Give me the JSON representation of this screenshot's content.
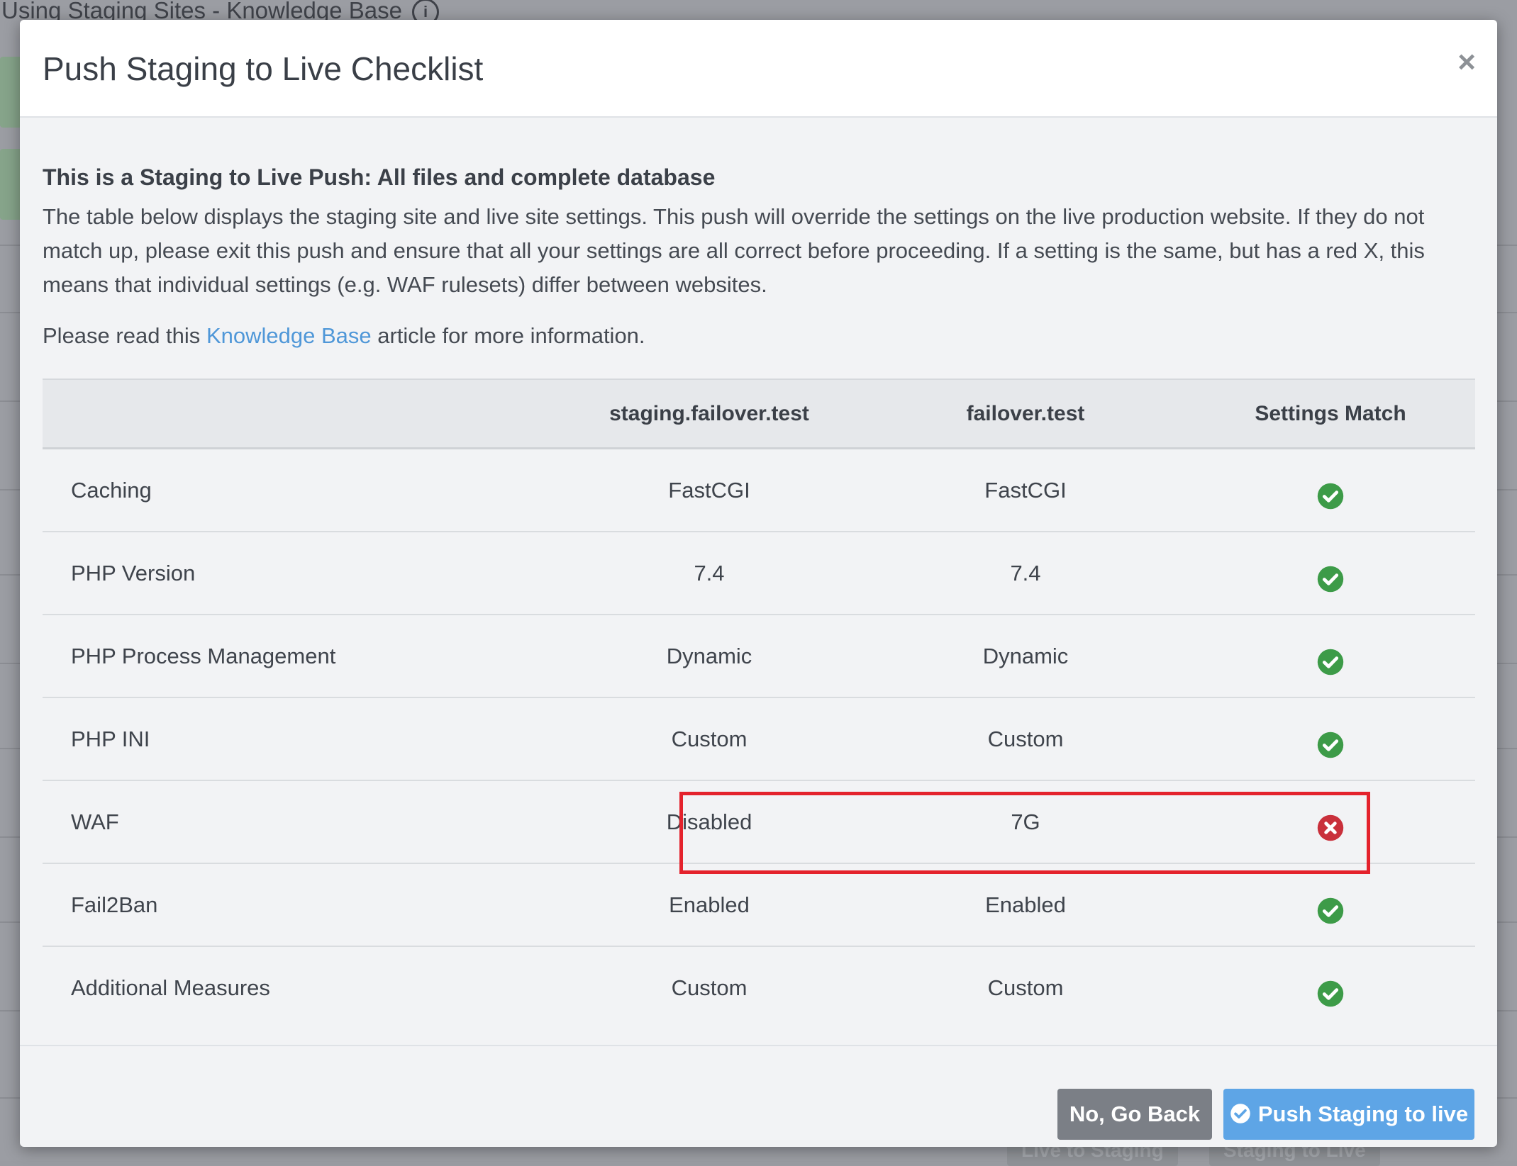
{
  "background": {
    "page_title": "Using Staging Sites - Knowledge Base",
    "bottom_buttons": [
      "Live to Staging",
      "Staging to Live"
    ]
  },
  "modal": {
    "title": "Push Staging to Live Checklist",
    "close_label": "×",
    "subtitle": "This is a Staging to Live Push: All files and complete database",
    "description": "The table below displays the staging site and live site settings. This push will override the settings on the live production website. If they do not match up, please exit this push and ensure that all your settings are all correct before proceeding. If a setting is the same, but has a red X, this means that individual settings (e.g. WAF rulesets) differ between websites.",
    "read_prefix": "Please read this",
    "read_link": "Knowledge Base",
    "read_suffix": "article for more information.",
    "table": {
      "headers": [
        "",
        "staging.failover.test",
        "failover.test",
        "Settings Match"
      ],
      "rows": [
        {
          "setting": "Caching",
          "staging": "FastCGI",
          "live": "FastCGI",
          "match": true
        },
        {
          "setting": "PHP Version",
          "staging": "7.4",
          "live": "7.4",
          "match": true
        },
        {
          "setting": "PHP Process Management",
          "staging": "Dynamic",
          "live": "Dynamic",
          "match": true
        },
        {
          "setting": "PHP INI",
          "staging": "Custom",
          "live": "Custom",
          "match": true
        },
        {
          "setting": "WAF",
          "staging": "Disabled",
          "live": "7G",
          "match": false
        },
        {
          "setting": "Fail2Ban",
          "staging": "Enabled",
          "live": "Enabled",
          "match": true
        },
        {
          "setting": "Additional Measures",
          "staging": "Custom",
          "live": "Custom",
          "match": true
        }
      ]
    },
    "buttons": {
      "back": "No, Go Back",
      "push": "Push Staging to live"
    }
  },
  "colors": {
    "match_green": "#3d9b48",
    "mismatch_red": "#c9303b",
    "highlight_red": "#e4222c",
    "link_blue": "#4f97d8",
    "primary_button": "#5ea5e6",
    "secondary_button": "#7b7f86"
  }
}
